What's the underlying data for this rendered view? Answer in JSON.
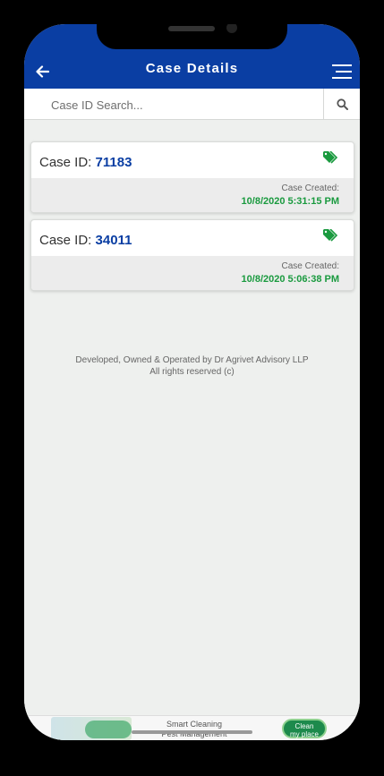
{
  "header": {
    "title": "Case Details"
  },
  "search": {
    "placeholder": "Case ID Search..."
  },
  "cases": [
    {
      "label": "Case ID:",
      "id": "71183",
      "created_label": "Case Created:",
      "created_date": "10/8/2020 5:31:15 PM"
    },
    {
      "label": "Case ID:",
      "id": "34011",
      "created_label": "Case Created:",
      "created_date": "10/8/2020 5:06:38 PM"
    }
  ],
  "footer": {
    "line1": "Developed, Owned & Operated by Dr Agrivet Advisory LLP",
    "line2": "All rights reserved (c)"
  },
  "ad": {
    "line1": "Smart Cleaning",
    "line2": "Pest Management",
    "logo_line1": "Clean",
    "logo_line2": "my place"
  },
  "colors": {
    "appbar": "#0a3ea3",
    "case_id": "#0a3ea3",
    "created_date": "#1a9a3f",
    "tag": "#1a9a3f"
  },
  "icons": {
    "back": "arrow-left-icon",
    "menu": "hamburger-menu-icon",
    "search": "search-icon",
    "tag": "tags-icon"
  }
}
